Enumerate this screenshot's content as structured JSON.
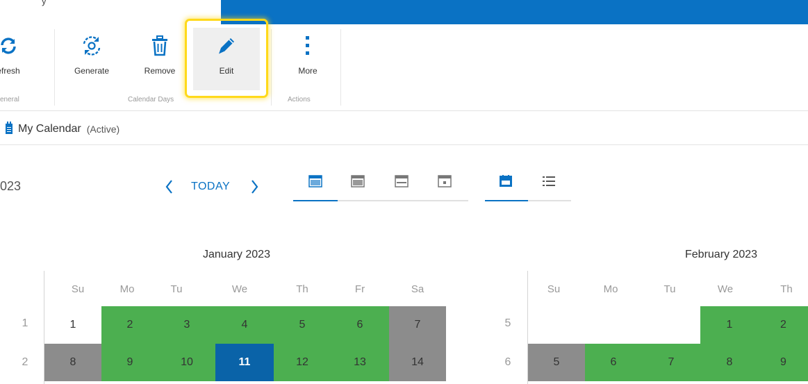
{
  "window": {
    "title_fragment": "y"
  },
  "ribbon": {
    "buttons": [
      {
        "label": "efresh",
        "icon": "refresh-icon"
      },
      {
        "label": "Generate",
        "icon": "generate-icon"
      },
      {
        "label": "Remove",
        "icon": "trash-icon"
      },
      {
        "label": "Edit",
        "icon": "pencil-icon"
      },
      {
        "label": "More",
        "icon": "more-vertical-icon"
      }
    ],
    "groups": [
      "eneral",
      "Calendar Days",
      "Actions"
    ]
  },
  "calendar_header": {
    "name": "My Calendar",
    "status": "(Active)"
  },
  "toolbar": {
    "year_fragment": "023",
    "today_label": "TODAY",
    "prev_icon": "chevron-left-icon",
    "next_icon": "chevron-right-icon",
    "view_icons": [
      "year-view-icon",
      "month-view-icon",
      "week-view-icon",
      "day-view-icon"
    ],
    "mode_icons": [
      "calendar-mode-icon",
      "list-mode-icon"
    ]
  },
  "months": [
    {
      "title": "January 2023",
      "days_of_week": [
        "Su",
        "Mo",
        "Tu",
        "We",
        "Th",
        "Fr",
        "Sa"
      ],
      "weeks": [
        {
          "number": "1",
          "days": [
            "1",
            "2",
            "3",
            "4",
            "5",
            "6",
            "7"
          ]
        },
        {
          "number": "2",
          "days": [
            "8",
            "9",
            "10",
            "11",
            "12",
            "13",
            "14"
          ]
        }
      ]
    },
    {
      "title": "February 2023",
      "days_of_week": [
        "Su",
        "Mo",
        "Tu",
        "We",
        "Th"
      ],
      "weeks": [
        {
          "number": "5",
          "days": [
            "",
            "",
            "",
            "1",
            "2"
          ]
        },
        {
          "number": "6",
          "days": [
            "5",
            "6",
            "7",
            "8",
            "9"
          ]
        }
      ]
    }
  ],
  "colors": {
    "accent": "#0a72c4",
    "working_day": "#4caf50",
    "non_working_day": "#8c8c8c",
    "selected_day": "#0a63a8",
    "highlight": "#ffd91a"
  }
}
